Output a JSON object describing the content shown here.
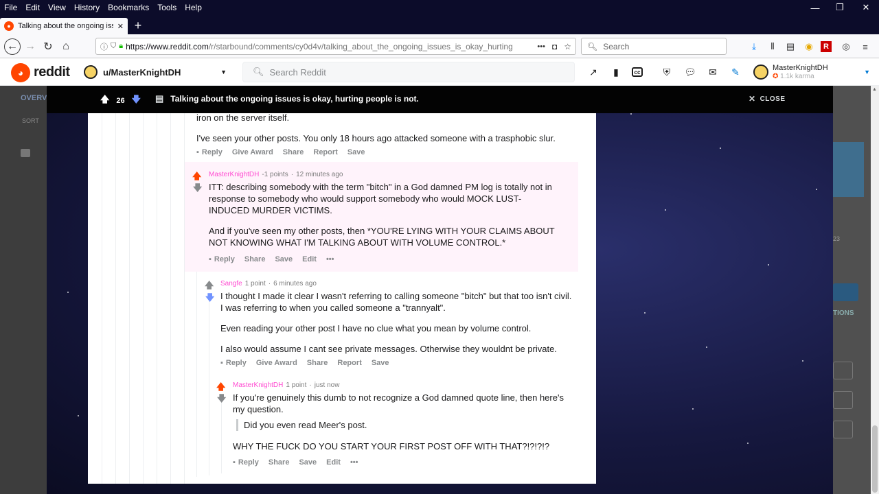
{
  "menubar": {
    "items": [
      "File",
      "Edit",
      "View",
      "History",
      "Bookmarks",
      "Tools",
      "Help"
    ]
  },
  "window_controls": {
    "minimize": "—",
    "restore": "❐",
    "close": "✕"
  },
  "tab": {
    "title": "Talking about the ongoing issu",
    "close": "✕",
    "new_tab": "+"
  },
  "nav": {
    "url_domain": "https://www.reddit.com",
    "url_path": "/r/starbound/comments/cy0d4v/talking_about_the_ongoing_issues_is_okay_hurting",
    "search_placeholder": "Search",
    "more": "•••"
  },
  "reddit_header": {
    "wordmark": "reddit",
    "community": "u/MasterKnightDH",
    "search_placeholder": "Search Reddit",
    "username": "MasterKnightDH",
    "karma": "1.1k karma"
  },
  "overlay": {
    "vote_count": "26",
    "post_title": "Talking about the ongoing issues is okay, hurting people is not.",
    "close_label": "CLOSE"
  },
  "comments": {
    "c0": {
      "text_partial": "iron on the server itself.",
      "text_2": "I've seen your other posts. You only 18 hours ago attacked someone with a trasphobic slur.",
      "actions": [
        "Reply",
        "Give Award",
        "Share",
        "Report",
        "Save"
      ]
    },
    "c1": {
      "author": "MasterKnightDH",
      "points": "-1 points",
      "time": "12 minutes ago",
      "para1": "ITT: describing somebody with the term \"bitch\" in a God damned PM log is totally not in response to somebody who would support somebody who would MOCK LUST-INDUCED MURDER VICTIMS.",
      "para2": "And if you've seen my other posts, then *YOU'RE LYING WITH YOUR CLAIMS ABOUT NOT KNOWING WHAT I'M TALKING ABOUT WITH VOLUME CONTROL.*",
      "actions": [
        "Reply",
        "Share",
        "Save",
        "Edit",
        "•••"
      ]
    },
    "c2": {
      "author": "Sangfe",
      "points": "1 point",
      "time": "6 minutes ago",
      "para1": "I thought I made it clear I wasn't referring to calling someone \"bitch\" but that too isn't civil. I was referring to when you called someone a \"trannyalt\".",
      "para2": "Even reading your other post I have no clue what you mean by volume control.",
      "para3": "I also would assume I cant see private messages. Otherwise they wouldnt be private.",
      "actions": [
        "Reply",
        "Give Award",
        "Share",
        "Report",
        "Save"
      ]
    },
    "c3": {
      "author": "MasterKnightDH",
      "points": "1 point",
      "time": "just now",
      "para1": "If you're genuinely this dumb to not recognize a God damned quote line, then here's my question.",
      "quote": "Did you even read Meer's post.",
      "para2": "WHY THE FUCK DO YOU START YOUR FIRST POST OFF WITH THAT?!?!?!?",
      "actions": [
        "Reply",
        "Share",
        "Save",
        "Edit",
        "•••"
      ]
    }
  },
  "bg_text": {
    "overview": "OVERV",
    "sort": "SORT",
    "options": "TIONS",
    "num": "23"
  },
  "colors": {
    "reddit_orange": "#ff4500",
    "downvote_blue": "#7193ff",
    "author_pink": "#ff4bd1",
    "highlight": "#fff3fb"
  }
}
